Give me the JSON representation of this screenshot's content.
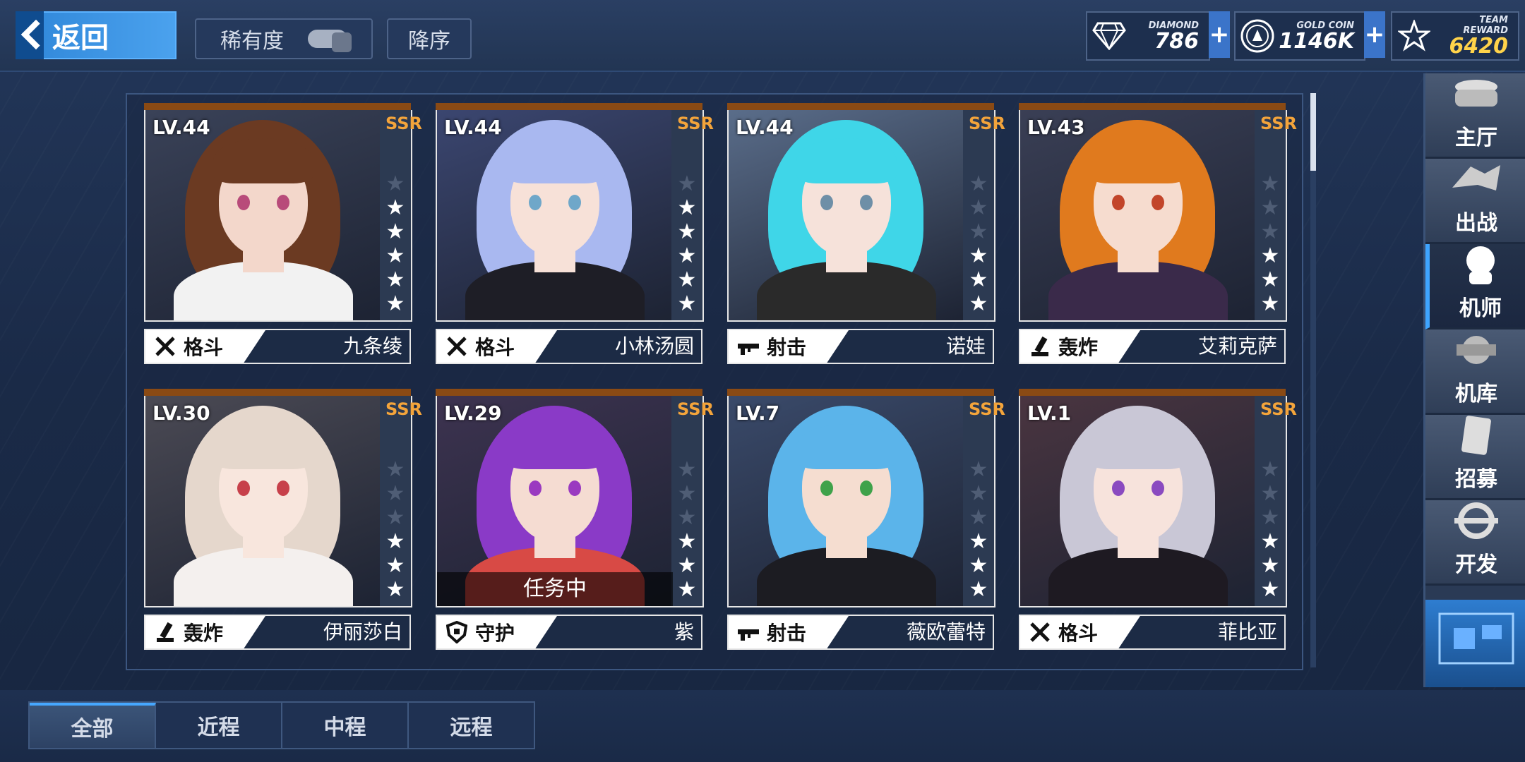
{
  "header": {
    "back_label": "返回",
    "sort_rarity_label": "稀有度",
    "sort_order_label": "降序",
    "currencies": [
      {
        "label": "DIAMOND",
        "value": "786",
        "icon": "diamond-icon"
      },
      {
        "label": "GOLD COIN",
        "value": "1146K",
        "icon": "gold-coin-icon"
      },
      {
        "label": "TEAM REWARD",
        "value": "6420",
        "icon": "team-reward-icon"
      }
    ],
    "plus_label": "+"
  },
  "cards": [
    {
      "level": "LV.44",
      "rarity": "SSR",
      "stars": 5,
      "max_stars": 6,
      "type": "格斗",
      "type_icon": "melee-icon",
      "name": "九条绫",
      "status": ""
    },
    {
      "level": "LV.44",
      "rarity": "SSR",
      "stars": 5,
      "max_stars": 6,
      "type": "格斗",
      "type_icon": "melee-icon",
      "name": "小林汤圆",
      "status": ""
    },
    {
      "level": "LV.44",
      "rarity": "SSR",
      "stars": 3,
      "max_stars": 6,
      "type": "射击",
      "type_icon": "rifle-icon",
      "name": "诺娃",
      "status": ""
    },
    {
      "level": "LV.43",
      "rarity": "SSR",
      "stars": 3,
      "max_stars": 6,
      "type": "轰炸",
      "type_icon": "mortar-icon",
      "name": "艾莉克萨",
      "status": ""
    },
    {
      "level": "LV.30",
      "rarity": "SSR",
      "stars": 3,
      "max_stars": 6,
      "type": "轰炸",
      "type_icon": "mortar-icon",
      "name": "伊丽莎白",
      "status": ""
    },
    {
      "level": "LV.29",
      "rarity": "SSR",
      "stars": 3,
      "max_stars": 6,
      "type": "守护",
      "type_icon": "shield-icon",
      "name": "紫",
      "status": "任务中"
    },
    {
      "level": "LV.7",
      "rarity": "SSR",
      "stars": 3,
      "max_stars": 6,
      "type": "射击",
      "type_icon": "rifle-icon",
      "name": "薇欧蕾特",
      "status": ""
    },
    {
      "level": "LV.1",
      "rarity": "SSR",
      "stars": 3,
      "max_stars": 6,
      "type": "格斗",
      "type_icon": "melee-icon",
      "name": "菲比亚",
      "status": ""
    }
  ],
  "nav": [
    {
      "label": "主厅",
      "icon": "lobby-icon"
    },
    {
      "label": "出战",
      "icon": "sortie-icon"
    },
    {
      "label": "机师",
      "icon": "pilot-icon",
      "active": true
    },
    {
      "label": "机库",
      "icon": "hangar-icon"
    },
    {
      "label": "招募",
      "icon": "recruit-icon"
    },
    {
      "label": "开发",
      "icon": "develop-icon"
    }
  ],
  "tabs": [
    {
      "label": "全部",
      "active": true
    },
    {
      "label": "近程"
    },
    {
      "label": "中程"
    },
    {
      "label": "远程"
    }
  ],
  "colors": {
    "accent": "#3ea4ff",
    "ssr": "#f3a43b",
    "card_top": "#8a4a14"
  }
}
